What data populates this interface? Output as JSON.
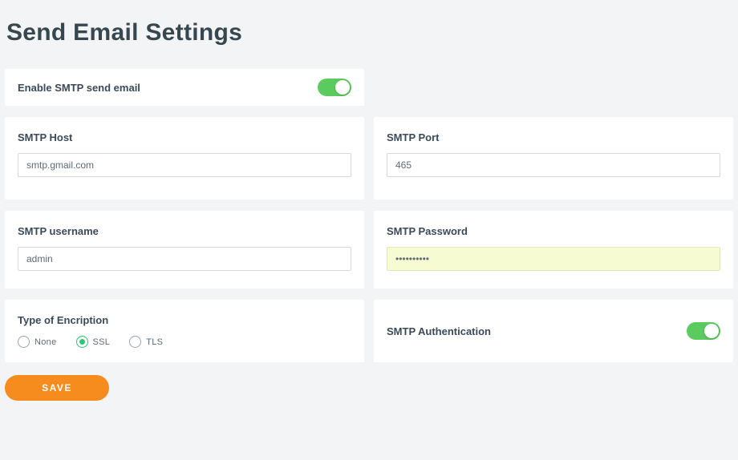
{
  "title": "Send Email Settings",
  "enable_smtp": {
    "label": "Enable SMTP send email",
    "value": true
  },
  "smtp_host": {
    "label": "SMTP Host",
    "value": "smtp.gmail.com"
  },
  "smtp_port": {
    "label": "SMTP Port",
    "value": "465"
  },
  "smtp_username": {
    "label": "SMTP username",
    "value": "admin"
  },
  "smtp_password": {
    "label": "SMTP Password",
    "value": "••••••••••"
  },
  "encryption": {
    "label": "Type of Encription",
    "options": {
      "none": "None",
      "ssl": "SSL",
      "tls": "TLS"
    },
    "selected": "ssl"
  },
  "smtp_auth": {
    "label": "SMTP Authentication",
    "value": true
  },
  "save_button": "SAVE"
}
